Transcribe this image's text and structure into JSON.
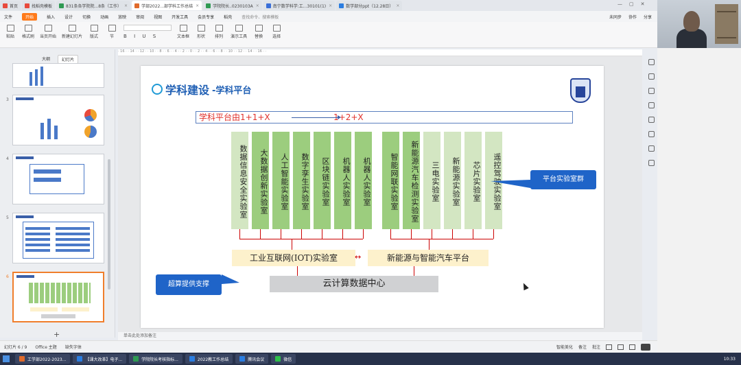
{
  "tabs": [
    {
      "label": "首页",
      "color": "#e84a3c"
    },
    {
      "label": "找稻壳模板",
      "color": "#e84a3c"
    },
    {
      "label": "831条各学院院...8条（工作）",
      "color": "#2f9a53"
    },
    {
      "label": "学部2022...部学科工作总结",
      "color": "#e06a2b"
    },
    {
      "label": "学院院长..0230103A",
      "color": "#2f9a53"
    },
    {
      "label": "南宁数学科学:工...30101(1)",
      "color": "#3a6fd8"
    },
    {
      "label": "数学部分ppt（12.28日）",
      "color": "#2b7de0"
    }
  ],
  "menus": [
    "文件",
    "开始",
    "插入",
    "设计",
    "切换",
    "动画",
    "放映",
    "审阅",
    "视图",
    "开发工具",
    "会员专享",
    "稻壳"
  ],
  "menu_selected": "开始",
  "search_placeholder": "查找命令、搜索模板",
  "menu_right": [
    "未同步",
    "协作",
    "分享"
  ],
  "toolbar": [
    {
      "label": "粘贴"
    },
    {
      "label": "格式刷"
    },
    {
      "label": "当页开始"
    },
    {
      "label": "新建幻灯片"
    },
    {
      "label": "版式"
    },
    {
      "label": "节"
    },
    {
      "label": "文本框"
    },
    {
      "label": "形状"
    },
    {
      "label": "排列"
    },
    {
      "label": "演示工具"
    },
    {
      "label": "替换"
    },
    {
      "label": "选择"
    }
  ],
  "thumb_tabs": [
    "大纲",
    "幻灯片"
  ],
  "thumb_numbers": [
    "3",
    "4",
    "5",
    "6"
  ],
  "slide": {
    "title": "学科建设",
    "subtitle": "-学科平台",
    "headline_left": "学科平台由1+1+X",
    "headline_right": "1+2+X",
    "labs_left": [
      "数据信息安全实验室",
      "大数据创新实验室",
      "人工智能实验室",
      "数字孪生实验室",
      "区块链实验室",
      "机器人实验室",
      "机器人实验室"
    ],
    "labs_right": [
      "智能网联实验室",
      "新能源汽车检测实验室",
      "三电实验室",
      "新能源实验室",
      "芯片实验室",
      "遥控驾驶实验室"
    ],
    "iot_box": "工业互联网(IOT)实验室",
    "ev_box": "新能源与智能汽车平台",
    "cloud_box": "云计算数据中心",
    "bubble_right": "平台实验室群",
    "bubble_left": "超算提供支撑",
    "double_arrow": "↔"
  },
  "notes": "单击此处添加备注",
  "status": {
    "slide_info": "幻灯片 6 / 9",
    "theme": "Office 主题",
    "font_missing": "缺失字体",
    "beautify": "智能美化",
    "notes_btn": "备注",
    "comment_btn": "批注"
  },
  "taskbar": [
    {
      "label": "工学部2022-2023...",
      "color": "#e06a2b"
    },
    {
      "label": "【课大改革】电子...",
      "color": "#2b7de0"
    },
    {
      "label": "学院院长考核指标...",
      "color": "#2f9a53"
    },
    {
      "label": "2022教工作总结",
      "color": "#2b7de0"
    },
    {
      "label": "腾讯会议",
      "color": "#2b7de0"
    },
    {
      "label": "微信",
      "color": "#2fbf4a"
    }
  ],
  "clock": "10:33"
}
